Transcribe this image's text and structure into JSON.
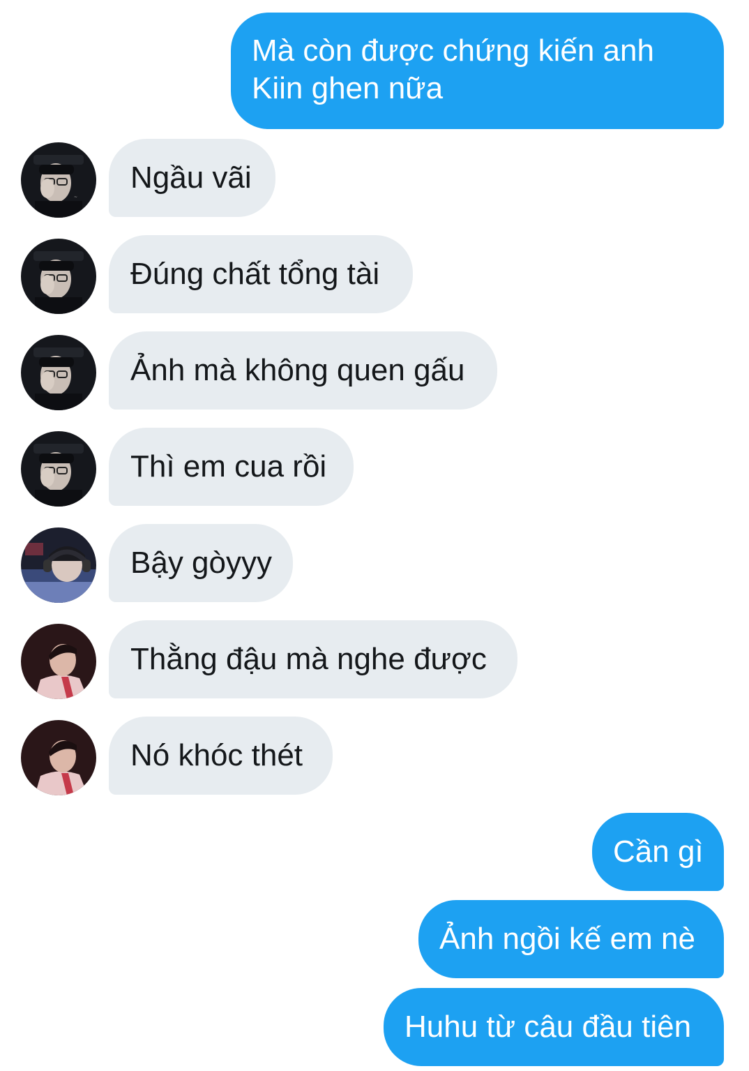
{
  "colors": {
    "outgoing_bubble": "#1da1f2",
    "incoming_bubble": "#e7ecf0",
    "outgoing_text": "#ffffff",
    "incoming_text": "#14171a"
  },
  "messages": [
    {
      "direction": "outgoing",
      "lines": [
        "Mà còn được chứng kiến anh",
        "Kiin ghen nữa"
      ]
    },
    {
      "direction": "incoming",
      "avatar": "avatar-dark-hat",
      "text": "Ngầu vãi"
    },
    {
      "direction": "incoming",
      "avatar": "avatar-dark-hat",
      "text": "Đúng chất tổng tài"
    },
    {
      "direction": "incoming",
      "avatar": "avatar-dark-hat",
      "text": "Ảnh mà không quen gấu"
    },
    {
      "direction": "incoming",
      "avatar": "avatar-dark-hat",
      "text": "Thì em cua rồi"
    },
    {
      "direction": "incoming",
      "avatar": "avatar-headset",
      "text": "Bậy gòyyy"
    },
    {
      "direction": "incoming",
      "avatar": "avatar-pink-jacket",
      "text": "Thằng đậu mà nghe được"
    },
    {
      "direction": "incoming",
      "avatar": "avatar-pink-jacket",
      "text": "Nó khóc thét"
    },
    {
      "direction": "outgoing",
      "text": "Cần gì"
    },
    {
      "direction": "outgoing",
      "text": "Ảnh ngồi kế em nè"
    },
    {
      "direction": "outgoing",
      "text": "Huhu từ câu đầu tiên"
    }
  ]
}
